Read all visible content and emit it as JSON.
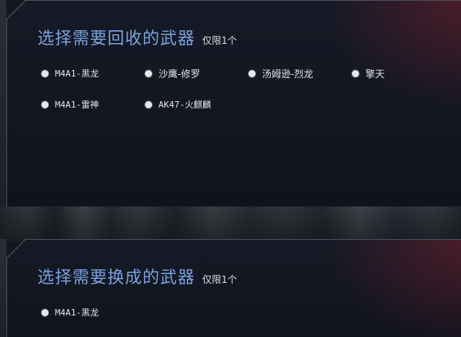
{
  "recycle_panel": {
    "title": "选择需要回收的武器",
    "limit": "仅限1个",
    "options": [
      {
        "label": "M4A1-黑龙"
      },
      {
        "label": "沙鹰-修罗"
      },
      {
        "label": "汤姆逊-烈龙"
      },
      {
        "label": "擎天"
      },
      {
        "label": "M4A1-雷神"
      },
      {
        "label": "AK47-火麒麟"
      }
    ]
  },
  "exchange_panel": {
    "title": "选择需要换成的武器",
    "limit": "仅限1个",
    "options": [
      {
        "label": "M4A1-黑龙"
      }
    ]
  },
  "colors": {
    "title": "#7aa3e0",
    "text": "#e2e5ec",
    "radio": "#e4e8f2",
    "panel_bg": "#0f131c",
    "accent_glow": "#781e2d"
  }
}
